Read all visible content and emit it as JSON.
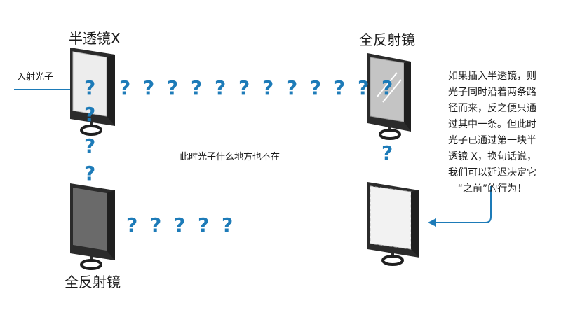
{
  "labels": {
    "top_left_mirror": "半透镜X",
    "top_right_mirror": "全反射镜",
    "bottom_left_mirror": "全反射镜",
    "incident_photon": "入射光子",
    "center_text": "此时光子什么地方也不在",
    "annotation": "如果插入半透镜，则\n光子同时沿着两条路\n径而来，反之便只通\n过其中一条。但此时\n光子已通过第一块半\n透镜 X，换句话说，\n我们可以延迟决定它\n“之前”的行为！"
  },
  "question_mark": "?",
  "colors": {
    "arrow": "#1d7bb8",
    "question": "#1d7bb8",
    "mirror_frame": "#2b2b2b",
    "semi_mirror_glass": "#e9e9e9",
    "full_mirror_glass": "#6a6a6a",
    "full_mirror_glass_light": "#bdbdbd",
    "empty_mirror_glass": "#f2f2f2"
  },
  "icons": {
    "mirror_top_left": "semi-transparent-mirror-icon",
    "mirror_top_right": "full-reflection-mirror-icon",
    "mirror_bottom_left": "full-reflection-mirror-icon",
    "mirror_bottom_right": "mirror-slot-icon"
  }
}
